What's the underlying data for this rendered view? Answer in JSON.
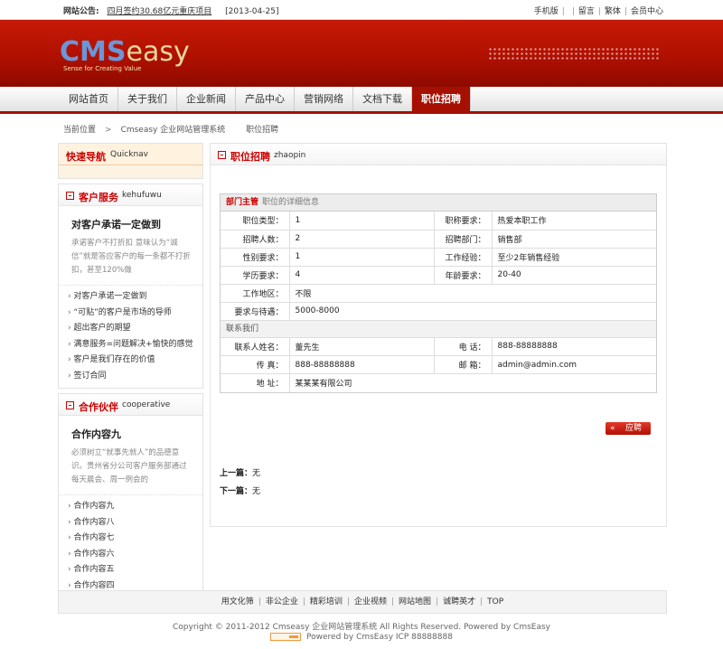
{
  "topbar": {
    "notice_label": "网站公告:",
    "notice_text": "四月签约30.68亿元重庆项目",
    "notice_date": "[2013-04-25]",
    "links": [
      "手机版",
      "留言",
      "繁体",
      "会员中心"
    ]
  },
  "header": {
    "logo_cms": "CMS",
    "logo_easy": "easy",
    "logo_tagline": "Sense for Creating Value"
  },
  "nav": {
    "items": [
      "网站首页",
      "关于我们",
      "企业新闻",
      "产品中心",
      "营销网络",
      "文档下载",
      "职位招聘"
    ]
  },
  "breadcrumb": {
    "items": [
      "当前位置",
      "Cmseasy 企业网站管理系统",
      "职位招聘"
    ]
  },
  "sidebar": {
    "quick_title": "快速导航",
    "quick_en": "Quicknav",
    "service_title": "客户服务",
    "service_en": "kehufuwu",
    "service_heading": "对客户承诺一定做到",
    "service_desc": "承诺客户不打折扣 意味认为“诚信”就是答应客户的每一条都不打折扣，甚至120%做",
    "service_items": [
      "对客户承诺一定做到",
      "“可贴”的客户是市场的导师",
      "超出客户的期望",
      "满意服务=问题解决+愉快的感觉",
      "客户是我们存在的价值",
      "签订合同"
    ],
    "partner_title": "合作伙伴",
    "partner_en": "cooperative",
    "partner_heading": "合作内容九",
    "partner_desc": "必须树立“就事先就人”的品德意识。贵州省分公司客户服务部通过每天晨会、周一例会的",
    "partner_items": [
      "合作内容九",
      "合作内容八",
      "合作内容七",
      "合作内容六",
      "合作内容五",
      "合作内容四"
    ]
  },
  "main": {
    "title": "职位招聘",
    "title_en": "zhaopin",
    "dept": "部门主管",
    "dept_sub": "职位的详细信息",
    "job": {
      "type_k": "职位类型：",
      "type_v": "1",
      "req_k": "职称要求：",
      "req_v": "热爱本职工作",
      "num_k": "招聘人数：",
      "num_v": "2",
      "dept_k": "招聘部门：",
      "dept_v": "销售部",
      "sex_k": "性别要求：",
      "sex_v": "1",
      "exp_k": "工作经验：",
      "exp_v": "至少2年销售经验",
      "edu_k": "学历要求：",
      "edu_v": "4",
      "age_k": "年龄要求：",
      "age_v": "20-40",
      "area_k": "工作地区：",
      "area_v": "不限",
      "salary_k": "要求与待遇：",
      "salary_v": "5000-8000"
    },
    "contact_title": "联系我们",
    "contact": {
      "name_k": "联系人姓名：",
      "name_v": "董先生",
      "tel_k": "电 话：",
      "tel_v": "888-88888888",
      "fax_k": "传 真：",
      "fax_v": "888-88888888",
      "email_k": "邮 箱：",
      "email_v": "admin@admin.com",
      "addr_k": "地 址：",
      "addr_v": "某某某有限公司"
    },
    "apply_arrow": "«",
    "apply_label": "应聘",
    "prev_label": "上一篇：",
    "prev_value": "无",
    "next_label": "下一篇：",
    "next_value": "无"
  },
  "footer": {
    "links": [
      "用文化筛",
      "非公企业",
      "精彩培训",
      "企业视频",
      "网站地图",
      "诚聘英才",
      "TOP"
    ],
    "copyright": "Copyright © 2011-2012 Cmseasy 企业网站管理系统  All Rights Reserved.  Powered by CmsEasy",
    "powered": "Powered by CmsEasy  ICP 88888888"
  }
}
